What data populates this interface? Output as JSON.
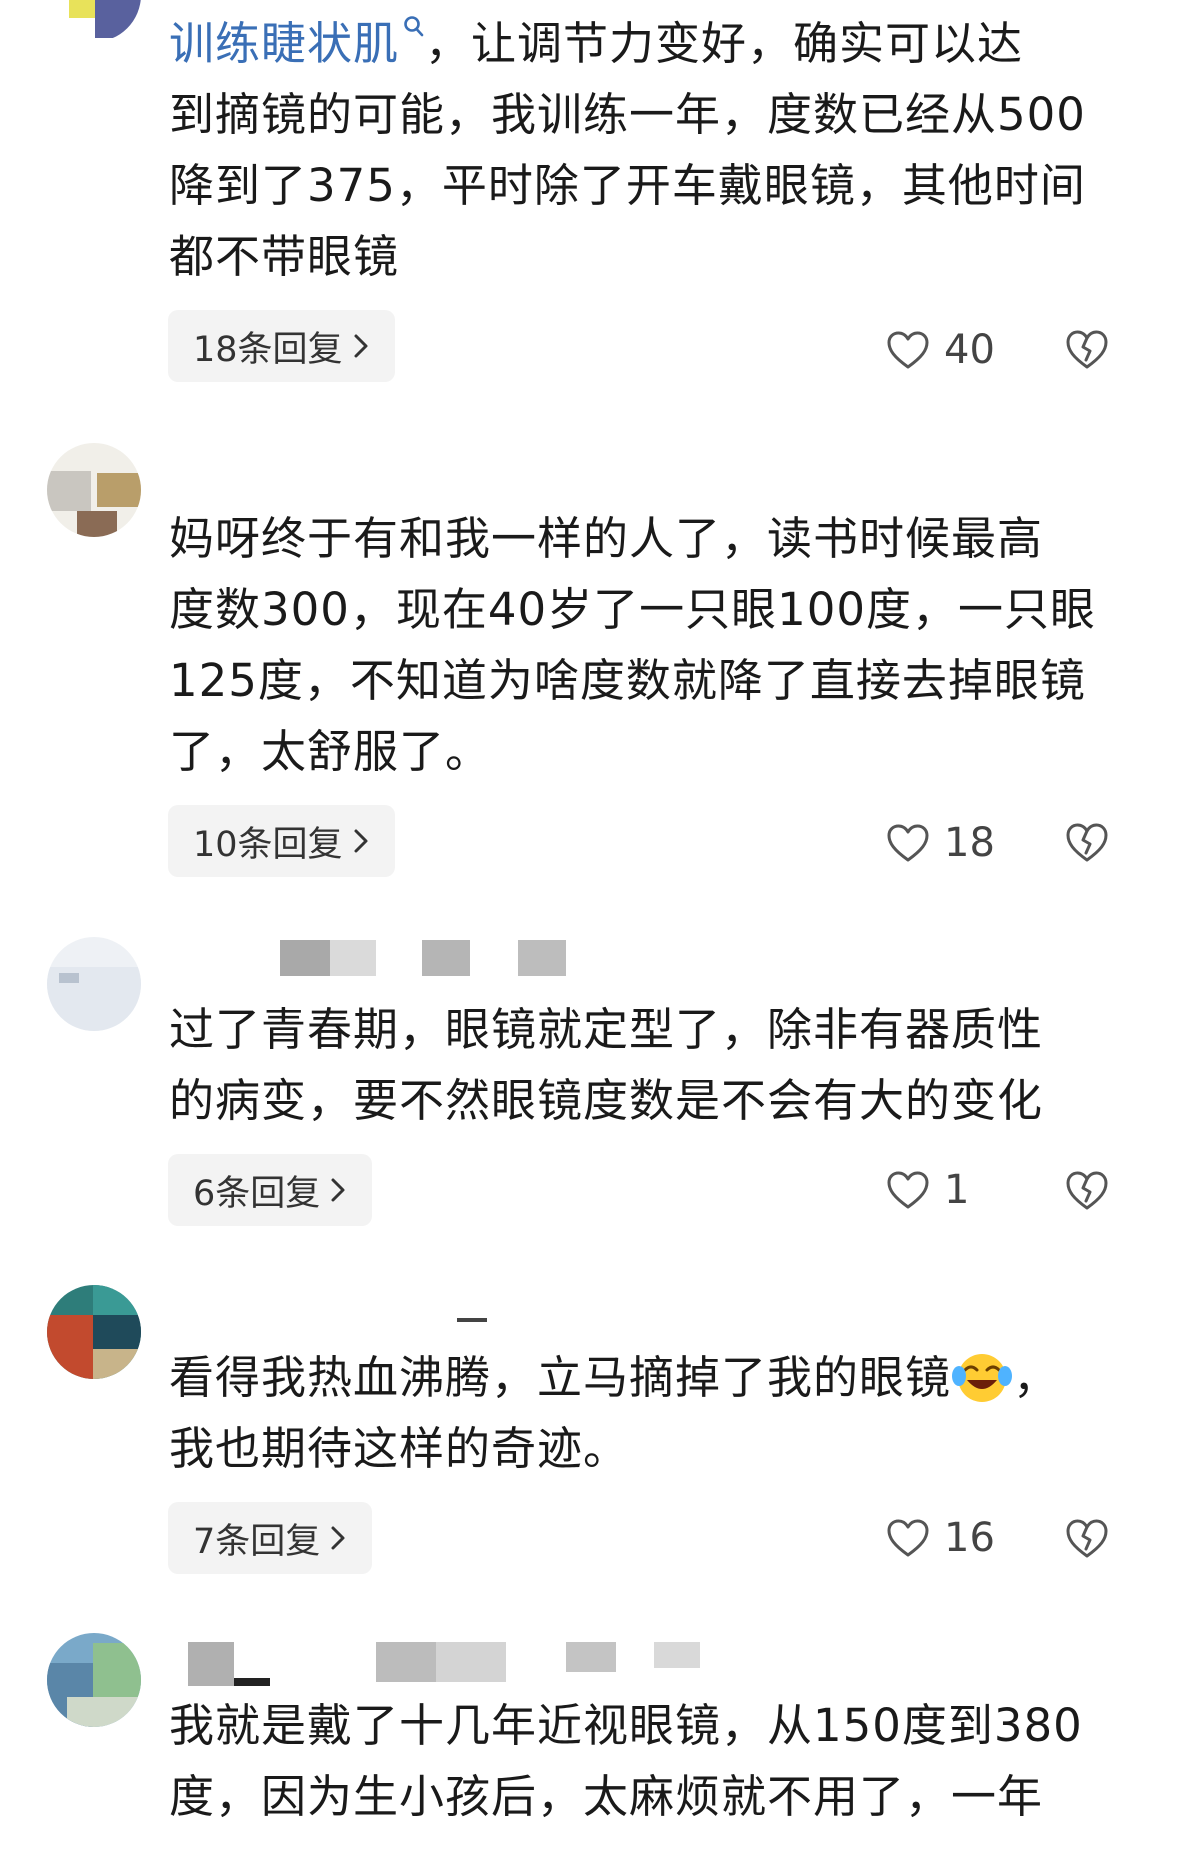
{
  "comments": [
    {
      "mention": "训练睫状肌",
      "lines": [
        "，让调节力变好，确实可以达",
        "到摘镜的可能，我训练一年，度数已经从500",
        "降到了375，平时除了开车戴眼镜，其他时间",
        "都不带眼镜"
      ],
      "replies": "18条回复",
      "likes": "40"
    },
    {
      "lines": [
        "妈呀终于有和我一样的人了，读书时候最高",
        "度数300，现在40岁了一只眼100度，一只眼",
        "125度，不知道为啥度数就降了直接去掉眼镜",
        "了，太舒服了。"
      ],
      "replies": "10条回复",
      "likes": "18"
    },
    {
      "lines": [
        "过了青春期，眼镜就定型了，除非有器质性",
        "的病变，要不然眼镜度数是不会有大的变化"
      ],
      "replies": "6条回复",
      "likes": "1"
    },
    {
      "lines": [
        "看得我热血沸腾，立马摘掉了我的眼镜",
        "我也期待这样的奇迹。"
      ],
      "line1_tail": "，",
      "emoji": "laughing-crying-face-emoji",
      "replies": "7条回复",
      "likes": "16"
    },
    {
      "lines": [
        "我就是戴了十几年近视眼镜，从150度到380",
        "度，因为生小孩后，太麻烦就不用了，一年"
      ]
    }
  ],
  "icons": {
    "like": "heart-outline-icon",
    "dislike": "broken-heart-icon",
    "reply_arrow": "chevron-right-icon",
    "search": "search-icon"
  },
  "colors": {
    "mention": "#3a6fb6",
    "text": "#1a1a1a",
    "reply_bg": "#f3f3f3"
  }
}
